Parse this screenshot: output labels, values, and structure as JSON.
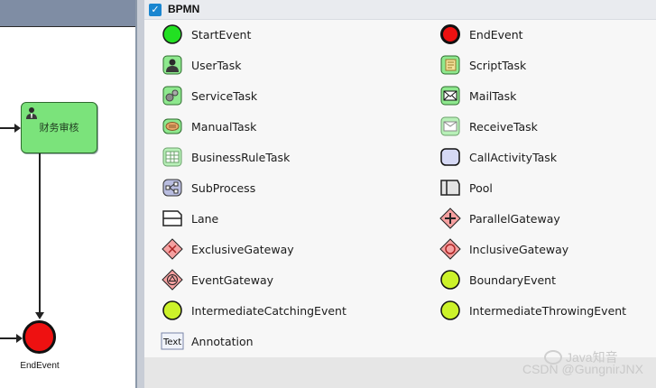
{
  "canvas": {
    "task_label": "财务审核",
    "end_label": "EndEvent"
  },
  "palette": {
    "title": "BPMN",
    "checked": true,
    "items": [
      {
        "label": "StartEvent",
        "icon": "start-event-icon"
      },
      {
        "label": "EndEvent",
        "icon": "end-event-icon"
      },
      {
        "label": "UserTask",
        "icon": "user-task-icon"
      },
      {
        "label": "ScriptTask",
        "icon": "script-task-icon"
      },
      {
        "label": "ServiceTask",
        "icon": "service-task-icon"
      },
      {
        "label": "MailTask",
        "icon": "mail-task-icon"
      },
      {
        "label": "ManualTask",
        "icon": "manual-task-icon"
      },
      {
        "label": "ReceiveTask",
        "icon": "receive-task-icon"
      },
      {
        "label": "BusinessRuleTask",
        "icon": "business-rule-task-icon"
      },
      {
        "label": "CallActivityTask",
        "icon": "call-activity-task-icon"
      },
      {
        "label": "SubProcess",
        "icon": "sub-process-icon"
      },
      {
        "label": "Pool",
        "icon": "pool-icon"
      },
      {
        "label": "Lane",
        "icon": "lane-icon"
      },
      {
        "label": "ParallelGateway",
        "icon": "parallel-gateway-icon"
      },
      {
        "label": "ExclusiveGateway",
        "icon": "exclusive-gateway-icon"
      },
      {
        "label": "InclusiveGateway",
        "icon": "inclusive-gateway-icon"
      },
      {
        "label": "EventGateway",
        "icon": "event-gateway-icon"
      },
      {
        "label": "BoundaryEvent",
        "icon": "boundary-event-icon"
      },
      {
        "label": "IntermediateCatchingEvent",
        "icon": "intermediate-catching-event-icon"
      },
      {
        "label": "IntermediateThrowingEvent",
        "icon": "intermediate-throwing-event-icon"
      },
      {
        "label": "Annotation",
        "icon": "annotation-icon",
        "icon_text": "Text"
      }
    ]
  },
  "watermark": {
    "text": "CSDN @GungnirJNX",
    "wechat_text": "Java知音"
  }
}
